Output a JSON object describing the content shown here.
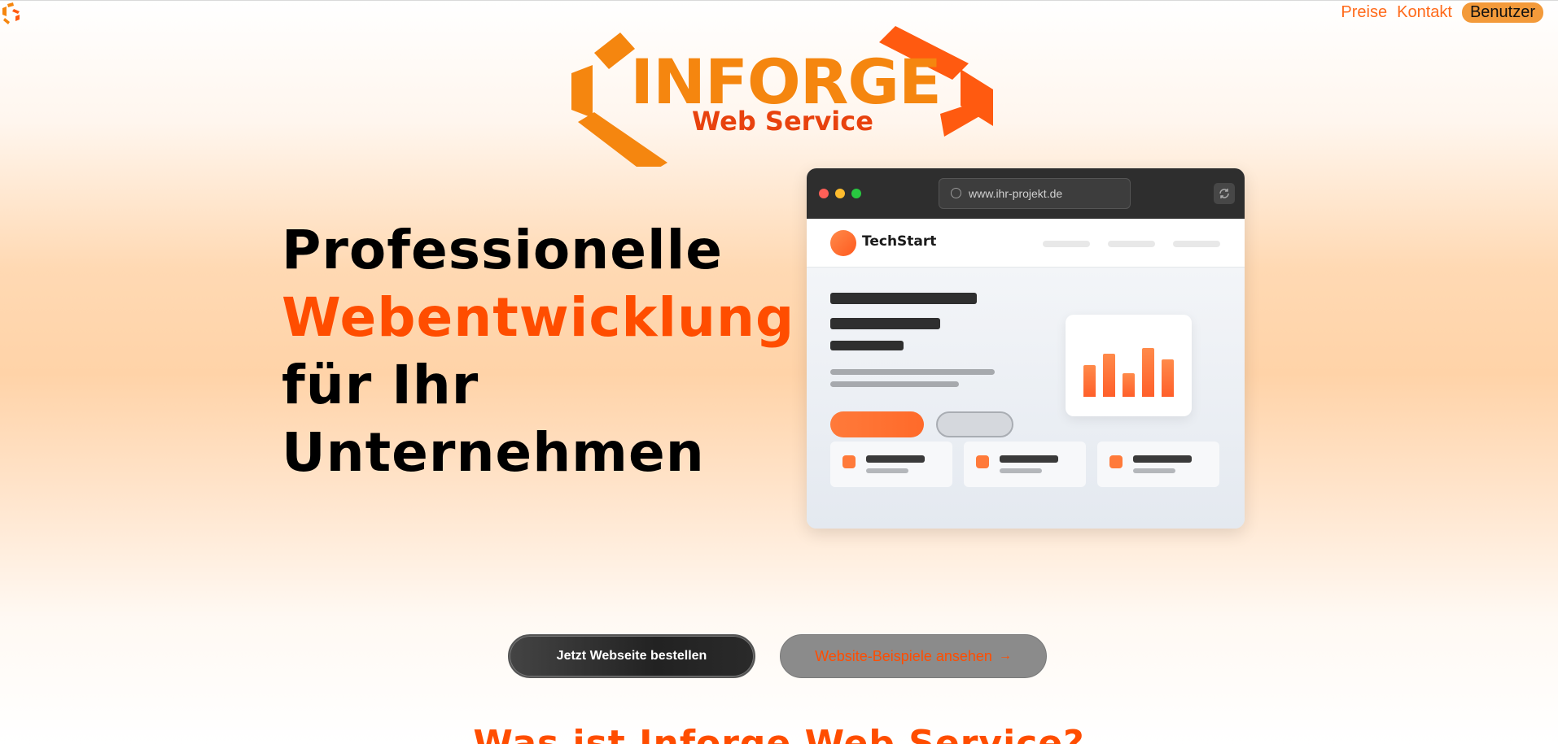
{
  "nav": {
    "items": [
      {
        "label": "Preise"
      },
      {
        "label": "Kontakt"
      }
    ],
    "user_button": "Benutzer"
  },
  "brand": {
    "name": "INFORGE",
    "subtitle": "Web Service",
    "colors": {
      "primary": "#f5860f",
      "secondary": "#e8420e"
    }
  },
  "hero": {
    "line1": "Professionelle",
    "line2": "Webentwicklung",
    "line3": "für Ihr",
    "line4": "Unternehmen",
    "accent_color": "#ff4d00"
  },
  "mockup": {
    "url": "www.ihr-projekt.de",
    "site_name": "TechStart",
    "chart_bars": [
      0.55,
      0.75,
      0.42,
      0.85,
      0.66
    ]
  },
  "cta": {
    "primary": "Jetzt Webseite bestellen",
    "secondary": "Website-Beispiele ansehen",
    "secondary_arrow": "→"
  },
  "section": {
    "title": "Was ist Inforge Web Service?"
  },
  "icons": [
    "inforge-logo-icon",
    "globe-icon",
    "reload-icon",
    "arrow-right-icon"
  ]
}
